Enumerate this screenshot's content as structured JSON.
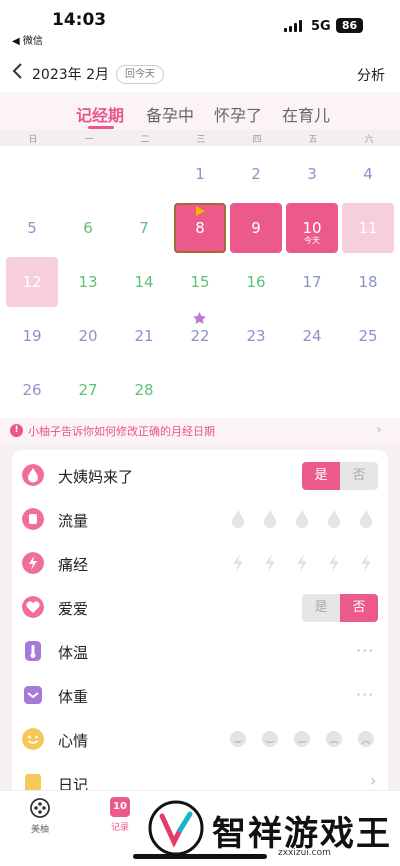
{
  "status_bar": {
    "time": "14:03",
    "back_app": "◀ 微信",
    "network": "5G",
    "battery": "86"
  },
  "nav": {
    "month_title": "2023年 2月",
    "today_button": "回今天",
    "analysis": "分析"
  },
  "tabs": [
    {
      "label": "记经期",
      "active": true
    },
    {
      "label": "备孕中",
      "active": false
    },
    {
      "label": "怀孕了",
      "active": false
    },
    {
      "label": "在育儿",
      "active": false
    }
  ],
  "weekdays": [
    "日",
    "一",
    "二",
    "三",
    "四",
    "五",
    "六"
  ],
  "calendar": {
    "days": [
      {
        "d": "1",
        "sub": ""
      },
      {
        "d": "2",
        "sub": ""
      },
      {
        "d": "3",
        "sub": ""
      },
      {
        "d": "4",
        "sub": ""
      },
      {
        "d": "5",
        "sub": ""
      },
      {
        "d": "6",
        "sub": ""
      },
      {
        "d": "7",
        "sub": ""
      },
      {
        "d": "8",
        "sub": ""
      },
      {
        "d": "9",
        "sub": ""
      },
      {
        "d": "10",
        "sub": "今天"
      },
      {
        "d": "11",
        "sub": ""
      },
      {
        "d": "12",
        "sub": ""
      },
      {
        "d": "13",
        "sub": ""
      },
      {
        "d": "14",
        "sub": ""
      },
      {
        "d": "15",
        "sub": ""
      },
      {
        "d": "16",
        "sub": ""
      },
      {
        "d": "17",
        "sub": ""
      },
      {
        "d": "18",
        "sub": ""
      },
      {
        "d": "19",
        "sub": ""
      },
      {
        "d": "20",
        "sub": ""
      },
      {
        "d": "21",
        "sub": ""
      },
      {
        "d": "22",
        "sub": ""
      },
      {
        "d": "23",
        "sub": ""
      },
      {
        "d": "24",
        "sub": ""
      },
      {
        "d": "25",
        "sub": ""
      },
      {
        "d": "26",
        "sub": ""
      },
      {
        "d": "27",
        "sub": ""
      },
      {
        "d": "28",
        "sub": ""
      }
    ]
  },
  "tip": {
    "text": "小柚子告诉你如何修改正确的月经日期"
  },
  "records": {
    "period": {
      "label": "大姨妈来了",
      "yes": "是",
      "no": "否"
    },
    "flow": {
      "label": "流量"
    },
    "cramps": {
      "label": "痛经"
    },
    "love": {
      "label": "爱爱",
      "yes": "是",
      "no": "否"
    },
    "temperature": {
      "label": "体温",
      "more": "···"
    },
    "weight": {
      "label": "体重",
      "more": "···"
    },
    "mood": {
      "label": "心情"
    },
    "diary": {
      "label": "日记"
    }
  },
  "bottom_nav": {
    "beauty": "美柚",
    "record": "记录",
    "record_date": "10"
  },
  "watermark": {
    "name": "智祥游戏王",
    "url": "zxxizui.com"
  },
  "colors": {
    "accent": "#e9558c",
    "period": "#ec5a8c",
    "period_light": "#f7cfdc",
    "green": "#5fc074",
    "blue": "#8c93c9"
  }
}
